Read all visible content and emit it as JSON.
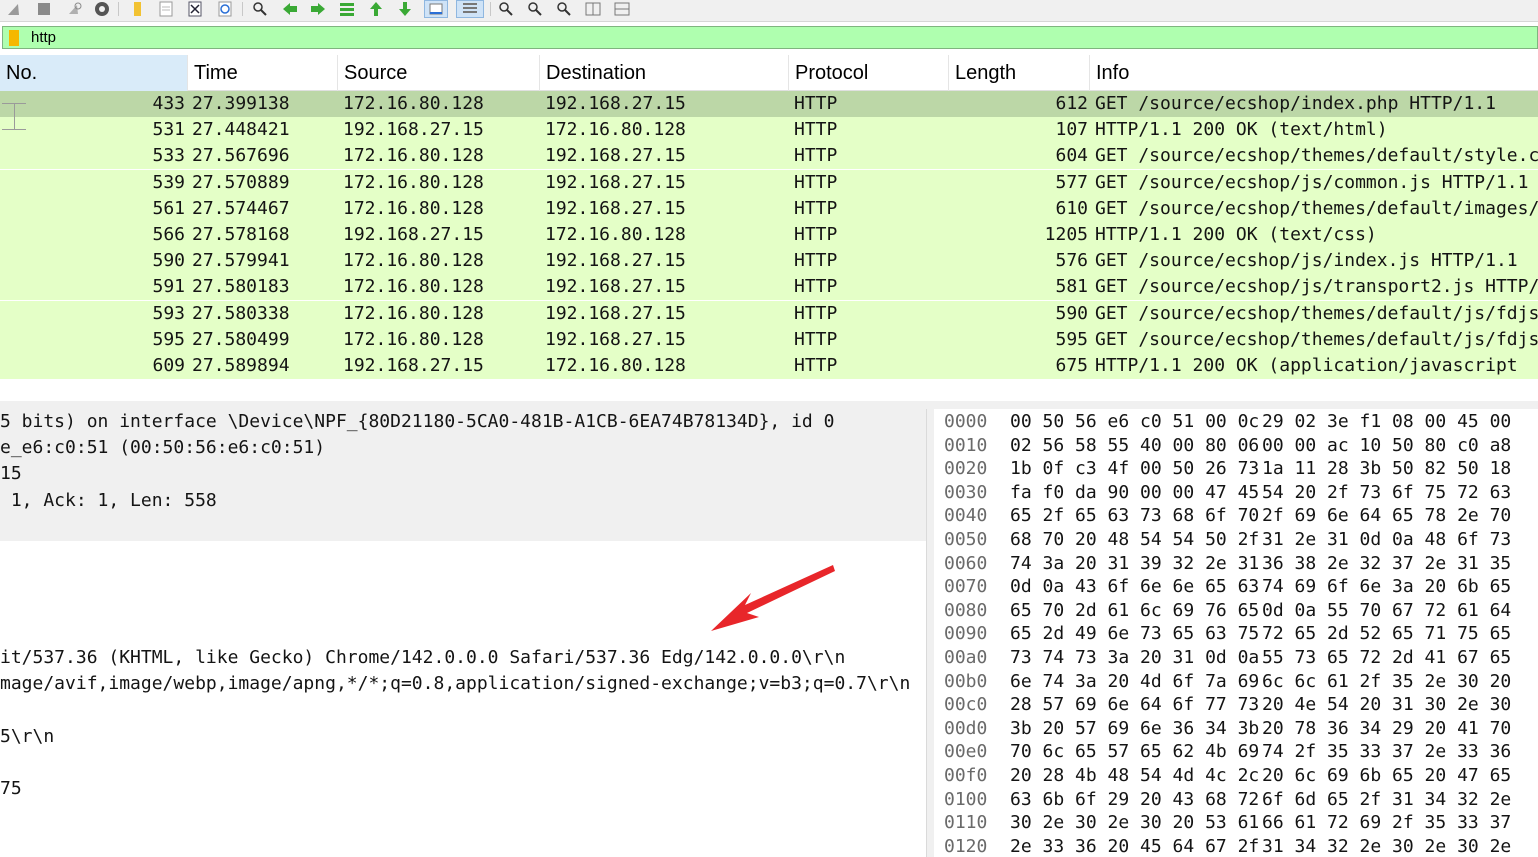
{
  "toolbar": {
    "icons": [
      "shark-fin-icon",
      "stop-icon",
      "restart-icon",
      "options-gear-icon",
      "open-folder-icon",
      "save-file-icon",
      "close-file-icon",
      "reload-icon",
      "find-icon",
      "go-back-icon",
      "go-forward-icon",
      "go-to-packet-icon",
      "first-packet-icon",
      "last-packet-icon",
      "autoscroll-icon",
      "colorize-icon",
      "zoom-in-icon",
      "zoom-out-icon",
      "zoom-normal-icon",
      "resize-columns-icon",
      "grid-icon"
    ]
  },
  "filter": {
    "value": "http",
    "background": "#afffaf"
  },
  "packet_list": {
    "columns": [
      "No.",
      "Time",
      "Source",
      "Destination",
      "Protocol",
      "Length",
      "Info"
    ],
    "rows": [
      {
        "no": "433",
        "time": "27.399138",
        "source": "172.16.80.128",
        "destination": "192.168.27.15",
        "protocol": "HTTP",
        "length": "612",
        "info": "GET /source/ecshop/index.php HTTP/1.1"
      },
      {
        "no": "531",
        "time": "27.448421",
        "source": "192.168.27.15",
        "destination": "172.16.80.128",
        "protocol": "HTTP",
        "length": "107",
        "info": "HTTP/1.1 200 OK  (text/html)"
      },
      {
        "no": "533",
        "time": "27.567696",
        "source": "172.16.80.128",
        "destination": "192.168.27.15",
        "protocol": "HTTP",
        "length": "604",
        "info": "GET /source/ecshop/themes/default/style.c"
      },
      {
        "no": "539",
        "time": "27.570889",
        "source": "172.16.80.128",
        "destination": "192.168.27.15",
        "protocol": "HTTP",
        "length": "577",
        "info": "GET /source/ecshop/js/common.js HTTP/1.1"
      },
      {
        "no": "561",
        "time": "27.574467",
        "source": "172.16.80.128",
        "destination": "192.168.27.15",
        "protocol": "HTTP",
        "length": "610",
        "info": "GET /source/ecshop/themes/default/images/"
      },
      {
        "no": "566",
        "time": "27.578168",
        "source": "192.168.27.15",
        "destination": "172.16.80.128",
        "protocol": "HTTP",
        "length": "1205",
        "info": "HTTP/1.1 200 OK  (text/css)"
      },
      {
        "no": "590",
        "time": "27.579941",
        "source": "172.16.80.128",
        "destination": "192.168.27.15",
        "protocol": "HTTP",
        "length": "576",
        "info": "GET /source/ecshop/js/index.js HTTP/1.1"
      },
      {
        "no": "591",
        "time": "27.580183",
        "source": "172.16.80.128",
        "destination": "192.168.27.15",
        "protocol": "HTTP",
        "length": "581",
        "info": "GET /source/ecshop/js/transport2.js HTTP/"
      },
      {
        "no": "593",
        "time": "27.580338",
        "source": "172.16.80.128",
        "destination": "192.168.27.15",
        "protocol": "HTTP",
        "length": "590",
        "info": "GET /source/ecshop/themes/default/js/fdjs"
      },
      {
        "no": "595",
        "time": "27.580499",
        "source": "172.16.80.128",
        "destination": "192.168.27.15",
        "protocol": "HTTP",
        "length": "595",
        "info": "GET /source/ecshop/themes/default/js/fdjs"
      },
      {
        "no": "609",
        "time": "27.589894",
        "source": "192.168.27.15",
        "destination": "172.16.80.128",
        "protocol": "HTTP",
        "length": "675",
        "info": "HTTP/1.1 200 OK  (application/javascript"
      }
    ],
    "row_color": "#e4ffc7",
    "selected_row_color": "#bcd7a7"
  },
  "details": {
    "lines": [
      "5 bits) on interface \\Device\\NPF_{80D21180-5CA0-481B-A1CB-6EA74B78134D}, id 0",
      "e_e6:c0:51 (00:50:56:e6:c0:51)",
      "15",
      " 1, Ack: 1, Len: 558",
      "it/537.36 (KHTML, like Gecko) Chrome/142.0.0.0 Safari/537.36 Edg/142.0.0.0\\r\\n",
      "mage/avif,image/webp,image/apng,*/*;q=0.8,application/signed-exchange;v=b3;q=0.7\\r\\n",
      "5\\r\\n",
      "75"
    ],
    "annotation_color": "#e8262a"
  },
  "bytes": {
    "rows": [
      {
        "offset": "0000",
        "h1": "00 50 56 e6 c0 51 00 0c",
        "h2": "29 02 3e f1 08 00 45 00"
      },
      {
        "offset": "0010",
        "h1": "02 56 58 55 40 00 80 06",
        "h2": "00 00 ac 10 50 80 c0 a8"
      },
      {
        "offset": "0020",
        "h1": "1b 0f c3 4f 00 50 26 73",
        "h2": "1a 11 28 3b 50 82 50 18"
      },
      {
        "offset": "0030",
        "h1": "fa f0 da 90 00 00 47 45",
        "h2": "54 20 2f 73 6f 75 72 63"
      },
      {
        "offset": "0040",
        "h1": "65 2f 65 63 73 68 6f 70",
        "h2": "2f 69 6e 64 65 78 2e 70"
      },
      {
        "offset": "0050",
        "h1": "68 70 20 48 54 54 50 2f",
        "h2": "31 2e 31 0d 0a 48 6f 73"
      },
      {
        "offset": "0060",
        "h1": "74 3a 20 31 39 32 2e 31",
        "h2": "36 38 2e 32 37 2e 31 35"
      },
      {
        "offset": "0070",
        "h1": "0d 0a 43 6f 6e 6e 65 63",
        "h2": "74 69 6f 6e 3a 20 6b 65"
      },
      {
        "offset": "0080",
        "h1": "65 70 2d 61 6c 69 76 65",
        "h2": "0d 0a 55 70 67 72 61 64"
      },
      {
        "offset": "0090",
        "h1": "65 2d 49 6e 73 65 63 75",
        "h2": "72 65 2d 52 65 71 75 65"
      },
      {
        "offset": "00a0",
        "h1": "73 74 73 3a 20 31 0d 0a",
        "h2": "55 73 65 72 2d 41 67 65"
      },
      {
        "offset": "00b0",
        "h1": "6e 74 3a 20 4d 6f 7a 69",
        "h2": "6c 6c 61 2f 35 2e 30 20"
      },
      {
        "offset": "00c0",
        "h1": "28 57 69 6e 64 6f 77 73",
        "h2": "20 4e 54 20 31 30 2e 30"
      },
      {
        "offset": "00d0",
        "h1": "3b 20 57 69 6e 36 34 3b",
        "h2": "20 78 36 34 29 20 41 70"
      },
      {
        "offset": "00e0",
        "h1": "70 6c 65 57 65 62 4b 69",
        "h2": "74 2f 35 33 37 2e 33 36"
      },
      {
        "offset": "00f0",
        "h1": "20 28 4b 48 54 4d 4c 2c",
        "h2": "20 6c 69 6b 65 20 47 65"
      },
      {
        "offset": "0100",
        "h1": "63 6b 6f 29 20 43 68 72",
        "h2": "6f 6d 65 2f 31 34 32 2e"
      },
      {
        "offset": "0110",
        "h1": "30 2e 30 2e 30 20 53 61",
        "h2": "66 61 72 69 2f 35 33 37"
      },
      {
        "offset": "0120",
        "h1": "2e 33 36 20 45 64 67 2f",
        "h2": "31 34 32 2e 30 2e 30 2e"
      }
    ]
  }
}
